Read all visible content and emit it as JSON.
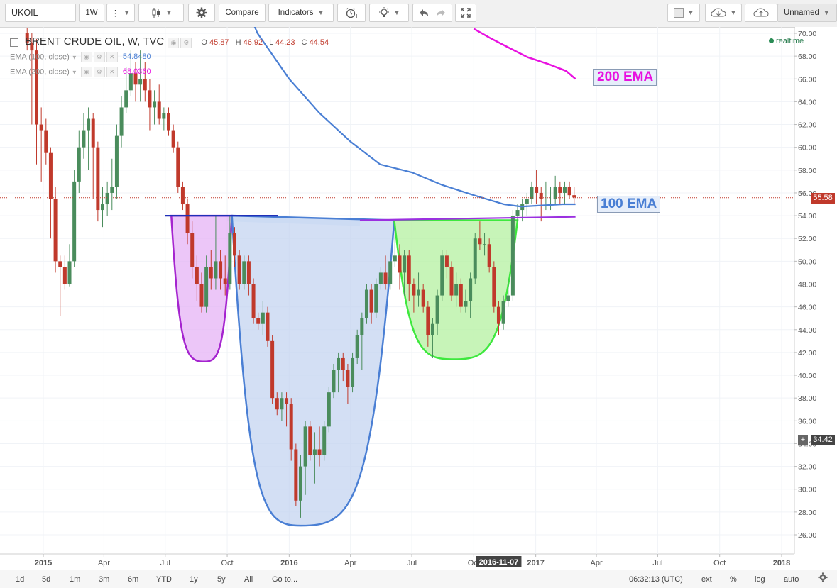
{
  "toolbar": {
    "symbol": "UKOIL",
    "interval": "1W",
    "compare_label": "Compare",
    "indicators_label": "Indicators",
    "layout_name": "Unnamed"
  },
  "legend": {
    "title": "BRENT CRUDE OIL, W, TVC",
    "o_label": "O",
    "o_value": "45.87",
    "h_label": "H",
    "h_value": "46.92",
    "l_label": "L",
    "l_value": "44.23",
    "c_label": "C",
    "c_value": "44.54",
    "ema100_label": "EMA (100, close)",
    "ema100_value": "54.8480",
    "ema200_label": "EMA (200, close)",
    "ema200_value": "68.0360"
  },
  "realtime_label": "realtime",
  "annotations": {
    "ema200": "200 EMA",
    "ema100": "100 EMA"
  },
  "price_axis": {
    "last_price": "55.58",
    "cursor_price": "34.42",
    "cursor_plus": "+"
  },
  "time_axis": {
    "highlight": "2016-11-07"
  },
  "bottombar": {
    "ranges": [
      "1d",
      "5d",
      "1m",
      "3m",
      "6m",
      "YTD",
      "1y",
      "5y",
      "All"
    ],
    "goto": "Go to...",
    "clock": "06:32:13 (UTC)",
    "ext": "ext",
    "pct": "%",
    "log": "log",
    "auto": "auto"
  },
  "colors": {
    "up": "#4a8c5c",
    "down": "#c0392b",
    "ema100": "#4a7fd4",
    "ema200": "#e812e0",
    "neckline_left": "#1f2fb8",
    "neckline_right": "#9b30e0",
    "cup_small_fill": "#e6b3f5",
    "cup_big_fill": "#c4d4f0",
    "cup_green_fill": "#b4f0a0",
    "cup_small_stroke": "#a524cf",
    "cup_big_stroke": "#4a7fd4",
    "cup_green_stroke": "#3ee83e"
  },
  "chart_data": {
    "type": "candlestick",
    "title": "BRENT CRUDE OIL, W, TVC",
    "y_range": [
      25,
      70.5
    ],
    "y_ticks": [
      70,
      68,
      66,
      64,
      62,
      60,
      58,
      56,
      54,
      52,
      50,
      48,
      46,
      44,
      42,
      40,
      38,
      36,
      34,
      32,
      30,
      28,
      26
    ],
    "x_range": [
      "2014-12-08",
      "2018-03-01"
    ],
    "x_ticks": [
      {
        "label": "2015",
        "date": "2015-01-01"
      },
      {
        "label": "Apr",
        "date": "2015-04-01"
      },
      {
        "label": "Jul",
        "date": "2015-07-01"
      },
      {
        "label": "Oct",
        "date": "2015-10-01"
      },
      {
        "label": "2016",
        "date": "2016-01-01"
      },
      {
        "label": "Apr",
        "date": "2016-04-01"
      },
      {
        "label": "Jul",
        "date": "2016-07-01"
      },
      {
        "label": "Oct",
        "date": "2016-10-01"
      },
      {
        "label": "2017",
        "date": "2017-01-01"
      },
      {
        "label": "Apr",
        "date": "2017-04-01"
      },
      {
        "label": "Jul",
        "date": "2017-07-01"
      },
      {
        "label": "Oct",
        "date": "2017-10-01"
      },
      {
        "label": "2018",
        "date": "2018-01-01"
      }
    ],
    "candles": [
      {
        "d": "2014-12-08",
        "o": 70.0,
        "h": 70.5,
        "l": 68.5,
        "c": 69.2
      },
      {
        "d": "2014-12-15",
        "o": 69.2,
        "h": 70.0,
        "l": 62.0,
        "c": 68.5
      },
      {
        "d": "2014-12-22",
        "o": 68.5,
        "h": 69.5,
        "l": 58.5,
        "c": 62.0
      },
      {
        "d": "2014-12-29",
        "o": 62.0,
        "h": 63.5,
        "l": 57.0,
        "c": 61.5
      },
      {
        "d": "2015-01-05",
        "o": 61.5,
        "h": 62.5,
        "l": 58.5,
        "c": 59.5
      },
      {
        "d": "2015-01-12",
        "o": 59.5,
        "h": 60.0,
        "l": 52.0,
        "c": 55.5
      },
      {
        "d": "2015-01-19",
        "o": 55.5,
        "h": 56.5,
        "l": 49.0,
        "c": 50.0
      },
      {
        "d": "2015-01-26",
        "o": 50.0,
        "h": 50.5,
        "l": 45.2,
        "c": 49.5
      },
      {
        "d": "2015-02-02",
        "o": 49.5,
        "h": 50.5,
        "l": 47.5,
        "c": 48.0
      },
      {
        "d": "2015-02-09",
        "o": 48.0,
        "h": 51.5,
        "l": 47.8,
        "c": 50.0
      },
      {
        "d": "2015-02-16",
        "o": 50.0,
        "h": 58.0,
        "l": 49.5,
        "c": 57.0
      },
      {
        "d": "2015-02-23",
        "o": 57.0,
        "h": 61.5,
        "l": 56.0,
        "c": 60.0
      },
      {
        "d": "2015-03-02",
        "o": 60.0,
        "h": 63.0,
        "l": 59.0,
        "c": 61.5
      },
      {
        "d": "2015-03-09",
        "o": 61.5,
        "h": 63.5,
        "l": 58.0,
        "c": 62.5
      },
      {
        "d": "2015-03-16",
        "o": 62.5,
        "h": 63.0,
        "l": 55.5,
        "c": 60.0
      },
      {
        "d": "2015-03-23",
        "o": 60.0,
        "h": 60.5,
        "l": 53.5,
        "c": 54.5
      },
      {
        "d": "2015-03-30",
        "o": 54.5,
        "h": 56.5,
        "l": 53.0,
        "c": 55.0
      },
      {
        "d": "2015-04-06",
        "o": 55.0,
        "h": 57.0,
        "l": 54.0,
        "c": 56.0
      },
      {
        "d": "2015-04-13",
        "o": 56.0,
        "h": 59.0,
        "l": 54.5,
        "c": 56.5
      },
      {
        "d": "2015-04-20",
        "o": 56.5,
        "h": 62.0,
        "l": 55.5,
        "c": 61.0
      },
      {
        "d": "2015-04-27",
        "o": 61.0,
        "h": 64.5,
        "l": 60.0,
        "c": 63.5
      },
      {
        "d": "2015-05-04",
        "o": 63.5,
        "h": 67.0,
        "l": 63.0,
        "c": 65.0
      },
      {
        "d": "2015-05-11",
        "o": 65.0,
        "h": 68.5,
        "l": 64.5,
        "c": 66.5
      },
      {
        "d": "2015-05-18",
        "o": 66.5,
        "h": 67.5,
        "l": 64.0,
        "c": 65.5
      },
      {
        "d": "2015-05-25",
        "o": 65.5,
        "h": 68.5,
        "l": 64.0,
        "c": 66.0
      },
      {
        "d": "2015-06-01",
        "o": 66.0,
        "h": 67.5,
        "l": 64.0,
        "c": 65.0
      },
      {
        "d": "2015-06-08",
        "o": 65.0,
        "h": 66.0,
        "l": 61.5,
        "c": 63.5
      },
      {
        "d": "2015-06-15",
        "o": 63.5,
        "h": 65.0,
        "l": 62.0,
        "c": 64.0
      },
      {
        "d": "2015-06-22",
        "o": 64.0,
        "h": 65.5,
        "l": 62.0,
        "c": 62.5
      },
      {
        "d": "2015-06-29",
        "o": 62.5,
        "h": 63.5,
        "l": 61.5,
        "c": 63.0
      },
      {
        "d": "2015-07-06",
        "o": 63.0,
        "h": 63.5,
        "l": 61.0,
        "c": 61.5
      },
      {
        "d": "2015-07-13",
        "o": 61.5,
        "h": 62.0,
        "l": 59.5,
        "c": 60.0
      },
      {
        "d": "2015-07-20",
        "o": 60.0,
        "h": 60.5,
        "l": 56.0,
        "c": 56.5
      },
      {
        "d": "2015-07-27",
        "o": 56.5,
        "h": 57.0,
        "l": 54.5,
        "c": 55.0
      },
      {
        "d": "2015-08-03",
        "o": 55.0,
        "h": 55.5,
        "l": 51.5,
        "c": 52.5
      },
      {
        "d": "2015-08-10",
        "o": 52.5,
        "h": 53.5,
        "l": 48.5,
        "c": 49.5
      },
      {
        "d": "2015-08-17",
        "o": 49.5,
        "h": 50.5,
        "l": 46.5,
        "c": 48.0
      },
      {
        "d": "2015-08-24",
        "o": 48.0,
        "h": 49.0,
        "l": 45.5,
        "c": 46.0
      },
      {
        "d": "2015-08-31",
        "o": 46.0,
        "h": 50.5,
        "l": 45.5,
        "c": 49.5
      },
      {
        "d": "2015-09-07",
        "o": 49.5,
        "h": 51.0,
        "l": 47.5,
        "c": 48.5
      },
      {
        "d": "2015-09-14",
        "o": 48.5,
        "h": 54.0,
        "l": 47.5,
        "c": 50.0
      },
      {
        "d": "2015-09-21",
        "o": 50.0,
        "h": 51.0,
        "l": 47.5,
        "c": 48.5
      },
      {
        "d": "2015-09-28",
        "o": 48.5,
        "h": 50.5,
        "l": 47.0,
        "c": 48.0
      },
      {
        "d": "2015-10-05",
        "o": 48.0,
        "h": 54.0,
        "l": 47.5,
        "c": 52.5
      },
      {
        "d": "2015-10-12",
        "o": 52.5,
        "h": 53.0,
        "l": 49.5,
        "c": 50.5
      },
      {
        "d": "2015-10-19",
        "o": 50.5,
        "h": 51.0,
        "l": 47.5,
        "c": 48.0
      },
      {
        "d": "2015-10-26",
        "o": 48.0,
        "h": 50.5,
        "l": 47.5,
        "c": 50.0
      },
      {
        "d": "2015-11-02",
        "o": 50.0,
        "h": 50.5,
        "l": 47.0,
        "c": 48.0
      },
      {
        "d": "2015-11-09",
        "o": 48.0,
        "h": 48.5,
        "l": 44.5,
        "c": 45.0
      },
      {
        "d": "2015-11-16",
        "o": 45.0,
        "h": 45.5,
        "l": 44.0,
        "c": 44.5
      },
      {
        "d": "2015-11-23",
        "o": 44.5,
        "h": 46.5,
        "l": 43.5,
        "c": 45.5
      },
      {
        "d": "2015-11-30",
        "o": 45.5,
        "h": 46.0,
        "l": 42.5,
        "c": 43.0
      },
      {
        "d": "2015-12-07",
        "o": 43.0,
        "h": 43.5,
        "l": 37.5,
        "c": 38.0
      },
      {
        "d": "2015-12-14",
        "o": 38.0,
        "h": 38.5,
        "l": 36.5,
        "c": 37.0
      },
      {
        "d": "2015-12-21",
        "o": 37.0,
        "h": 38.5,
        "l": 36.0,
        "c": 38.0
      },
      {
        "d": "2015-12-28",
        "o": 38.0,
        "h": 38.5,
        "l": 35.5,
        "c": 37.5
      },
      {
        "d": "2016-01-04",
        "o": 37.5,
        "h": 38.0,
        "l": 32.5,
        "c": 33.5
      },
      {
        "d": "2016-01-11",
        "o": 33.5,
        "h": 34.0,
        "l": 28.5,
        "c": 29.0
      },
      {
        "d": "2016-01-18",
        "o": 29.0,
        "h": 33.0,
        "l": 27.5,
        "c": 32.0
      },
      {
        "d": "2016-01-25",
        "o": 32.0,
        "h": 36.0,
        "l": 29.5,
        "c": 35.5
      },
      {
        "d": "2016-02-01",
        "o": 35.5,
        "h": 36.0,
        "l": 32.5,
        "c": 33.0
      },
      {
        "d": "2016-02-08",
        "o": 33.0,
        "h": 35.0,
        "l": 30.5,
        "c": 33.5
      },
      {
        "d": "2016-02-15",
        "o": 33.5,
        "h": 35.5,
        "l": 32.0,
        "c": 33.0
      },
      {
        "d": "2016-02-22",
        "o": 33.0,
        "h": 36.0,
        "l": 32.5,
        "c": 35.5
      },
      {
        "d": "2016-02-29",
        "o": 35.5,
        "h": 39.0,
        "l": 35.0,
        "c": 38.5
      },
      {
        "d": "2016-03-07",
        "o": 38.5,
        "h": 41.0,
        "l": 38.0,
        "c": 40.5
      },
      {
        "d": "2016-03-14",
        "o": 40.5,
        "h": 42.0,
        "l": 38.5,
        "c": 41.5
      },
      {
        "d": "2016-03-21",
        "o": 41.5,
        "h": 42.0,
        "l": 39.5,
        "c": 40.5
      },
      {
        "d": "2016-03-28",
        "o": 40.5,
        "h": 41.0,
        "l": 37.5,
        "c": 39.0
      },
      {
        "d": "2016-04-04",
        "o": 39.0,
        "h": 42.0,
        "l": 38.5,
        "c": 41.5
      },
      {
        "d": "2016-04-11",
        "o": 41.5,
        "h": 44.0,
        "l": 41.0,
        "c": 43.5
      },
      {
        "d": "2016-04-18",
        "o": 43.5,
        "h": 45.5,
        "l": 40.5,
        "c": 45.0
      },
      {
        "d": "2016-04-25",
        "o": 45.0,
        "h": 48.0,
        "l": 44.5,
        "c": 47.5
      },
      {
        "d": "2016-05-02",
        "o": 47.5,
        "h": 48.0,
        "l": 44.5,
        "c": 45.5
      },
      {
        "d": "2016-05-09",
        "o": 45.5,
        "h": 48.5,
        "l": 45.0,
        "c": 48.0
      },
      {
        "d": "2016-05-16",
        "o": 48.0,
        "h": 49.5,
        "l": 47.5,
        "c": 49.0
      },
      {
        "d": "2016-05-23",
        "o": 49.0,
        "h": 50.5,
        "l": 47.5,
        "c": 48.0
      },
      {
        "d": "2016-05-30",
        "o": 48.0,
        "h": 50.5,
        "l": 47.5,
        "c": 50.0
      },
      {
        "d": "2016-06-06",
        "o": 50.0,
        "h": 52.8,
        "l": 49.5,
        "c": 50.5
      },
      {
        "d": "2016-06-13",
        "o": 50.5,
        "h": 51.5,
        "l": 47.5,
        "c": 49.0
      },
      {
        "d": "2016-06-20",
        "o": 49.0,
        "h": 51.0,
        "l": 47.0,
        "c": 50.5
      },
      {
        "d": "2016-06-27",
        "o": 50.5,
        "h": 51.0,
        "l": 46.5,
        "c": 48.0
      },
      {
        "d": "2016-07-04",
        "o": 48.0,
        "h": 48.5,
        "l": 45.5,
        "c": 47.0
      },
      {
        "d": "2016-07-11",
        "o": 47.0,
        "h": 49.0,
        "l": 46.0,
        "c": 47.5
      },
      {
        "d": "2016-07-18",
        "o": 47.5,
        "h": 48.0,
        "l": 45.5,
        "c": 46.0
      },
      {
        "d": "2016-07-25",
        "o": 46.0,
        "h": 46.5,
        "l": 42.5,
        "c": 43.5
      },
      {
        "d": "2016-08-01",
        "o": 43.5,
        "h": 45.0,
        "l": 41.5,
        "c": 44.5
      },
      {
        "d": "2016-08-08",
        "o": 44.5,
        "h": 47.5,
        "l": 43.5,
        "c": 47.0
      },
      {
        "d": "2016-08-15",
        "o": 47.0,
        "h": 51.0,
        "l": 46.5,
        "c": 50.5
      },
      {
        "d": "2016-08-22",
        "o": 50.5,
        "h": 51.0,
        "l": 48.5,
        "c": 49.5
      },
      {
        "d": "2016-08-29",
        "o": 49.5,
        "h": 50.0,
        "l": 46.5,
        "c": 47.0
      },
      {
        "d": "2016-09-05",
        "o": 47.0,
        "h": 49.0,
        "l": 46.0,
        "c": 48.0
      },
      {
        "d": "2016-09-12",
        "o": 48.0,
        "h": 48.5,
        "l": 45.5,
        "c": 46.0
      },
      {
        "d": "2016-09-19",
        "o": 46.0,
        "h": 47.5,
        "l": 45.5,
        "c": 46.5
      },
      {
        "d": "2016-09-26",
        "o": 46.5,
        "h": 49.0,
        "l": 45.0,
        "c": 48.5
      },
      {
        "d": "2016-10-03",
        "o": 48.5,
        "h": 52.5,
        "l": 48.0,
        "c": 52.0
      },
      {
        "d": "2016-10-10",
        "o": 52.0,
        "h": 53.5,
        "l": 51.0,
        "c": 51.5
      },
      {
        "d": "2016-10-17",
        "o": 51.5,
        "h": 52.5,
        "l": 50.5,
        "c": 51.5
      },
      {
        "d": "2016-10-24",
        "o": 51.5,
        "h": 52.0,
        "l": 49.0,
        "c": 49.5
      },
      {
        "d": "2016-10-31",
        "o": 49.5,
        "h": 50.0,
        "l": 45.5,
        "c": 46.0
      },
      {
        "d": "2016-11-07",
        "o": 46.0,
        "h": 46.5,
        "l": 43.5,
        "c": 44.5
      },
      {
        "d": "2016-11-14",
        "o": 44.5,
        "h": 47.0,
        "l": 44.0,
        "c": 46.5
      },
      {
        "d": "2016-11-21",
        "o": 46.5,
        "h": 48.5,
        "l": 46.0,
        "c": 47.0
      },
      {
        "d": "2016-11-28",
        "o": 47.0,
        "h": 54.5,
        "l": 46.5,
        "c": 54.0
      },
      {
        "d": "2016-12-05",
        "o": 54.0,
        "h": 55.0,
        "l": 53.5,
        "c": 54.5
      },
      {
        "d": "2016-12-12",
        "o": 54.5,
        "h": 55.5,
        "l": 53.5,
        "c": 55.0
      },
      {
        "d": "2016-12-19",
        "o": 55.0,
        "h": 56.0,
        "l": 54.0,
        "c": 55.5
      },
      {
        "d": "2016-12-26",
        "o": 55.5,
        "h": 57.0,
        "l": 55.0,
        "c": 56.5
      },
      {
        "d": "2017-01-02",
        "o": 56.5,
        "h": 58.0,
        "l": 55.0,
        "c": 56.0
      },
      {
        "d": "2017-01-09",
        "o": 56.0,
        "h": 56.5,
        "l": 53.5,
        "c": 55.5
      },
      {
        "d": "2017-01-16",
        "o": 55.5,
        "h": 57.0,
        "l": 54.5,
        "c": 55.5
      },
      {
        "d": "2017-01-23",
        "o": 55.5,
        "h": 56.5,
        "l": 54.5,
        "c": 55.5
      },
      {
        "d": "2017-01-30",
        "o": 55.5,
        "h": 57.5,
        "l": 55.0,
        "c": 56.5
      },
      {
        "d": "2017-02-06",
        "o": 56.5,
        "h": 57.0,
        "l": 55.0,
        "c": 56.0
      },
      {
        "d": "2017-02-13",
        "o": 56.0,
        "h": 57.0,
        "l": 55.0,
        "c": 56.5
      },
      {
        "d": "2017-02-20",
        "o": 56.5,
        "h": 57.0,
        "l": 55.5,
        "c": 55.8
      },
      {
        "d": "2017-02-27",
        "o": 55.8,
        "h": 56.5,
        "l": 55.0,
        "c": 55.6
      }
    ],
    "ema100": [
      [
        "2015-10-10",
        75.0
      ],
      [
        "2015-11-15",
        70.0
      ],
      [
        "2016-01-01",
        66.0
      ],
      [
        "2016-02-15",
        63.0
      ],
      [
        "2016-04-01",
        60.5
      ],
      [
        "2016-05-15",
        58.5
      ],
      [
        "2016-07-01",
        57.8
      ],
      [
        "2016-08-15",
        56.7
      ],
      [
        "2016-10-01",
        55.8
      ],
      [
        "2016-11-15",
        55.0
      ],
      [
        "2016-12-10",
        54.8
      ],
      [
        "2017-01-10",
        54.9
      ],
      [
        "2017-02-10",
        55.0
      ],
      [
        "2017-03-01",
        55.0
      ]
    ],
    "ema200": [
      [
        "2016-10-01",
        70.4
      ],
      [
        "2016-10-25",
        69.6
      ],
      [
        "2016-11-20",
        68.8
      ],
      [
        "2016-12-20",
        67.9
      ],
      [
        "2017-01-20",
        67.3
      ],
      [
        "2017-02-15",
        66.7
      ],
      [
        "2017-03-01",
        66.0
      ]
    ],
    "necklines": [
      {
        "color": "left",
        "from": [
          "2015-07-01",
          54.0
        ],
        "to": [
          "2015-12-15",
          54.0
        ]
      },
      {
        "color": "right",
        "from": [
          "2016-04-15",
          53.6
        ],
        "to": [
          "2017-03-01",
          53.9
        ]
      }
    ],
    "shaded_band": {
      "from": [
        "2015-10-01",
        54.0
      ],
      "to": [
        "2016-04-15",
        53.6
      ]
    },
    "cups": [
      {
        "name": "small",
        "left": [
          "2015-07-10",
          54.0
        ],
        "bottom": [
          "2015-08-28",
          41.2
        ],
        "right": [
          "2015-10-08",
          54.0
        ]
      },
      {
        "name": "big",
        "left": [
          "2015-10-08",
          54.0
        ],
        "bottom": [
          "2016-01-18",
          26.8
        ],
        "right": [
          "2016-06-05",
          53.6
        ]
      },
      {
        "name": "green",
        "left": [
          "2016-06-05",
          53.6
        ],
        "bottom": [
          "2016-09-01",
          41.4
        ],
        "right": [
          "2016-12-05",
          53.6
        ]
      }
    ],
    "hlines": [
      {
        "y": 55.58,
        "style": "dotted",
        "color": "down"
      }
    ]
  }
}
